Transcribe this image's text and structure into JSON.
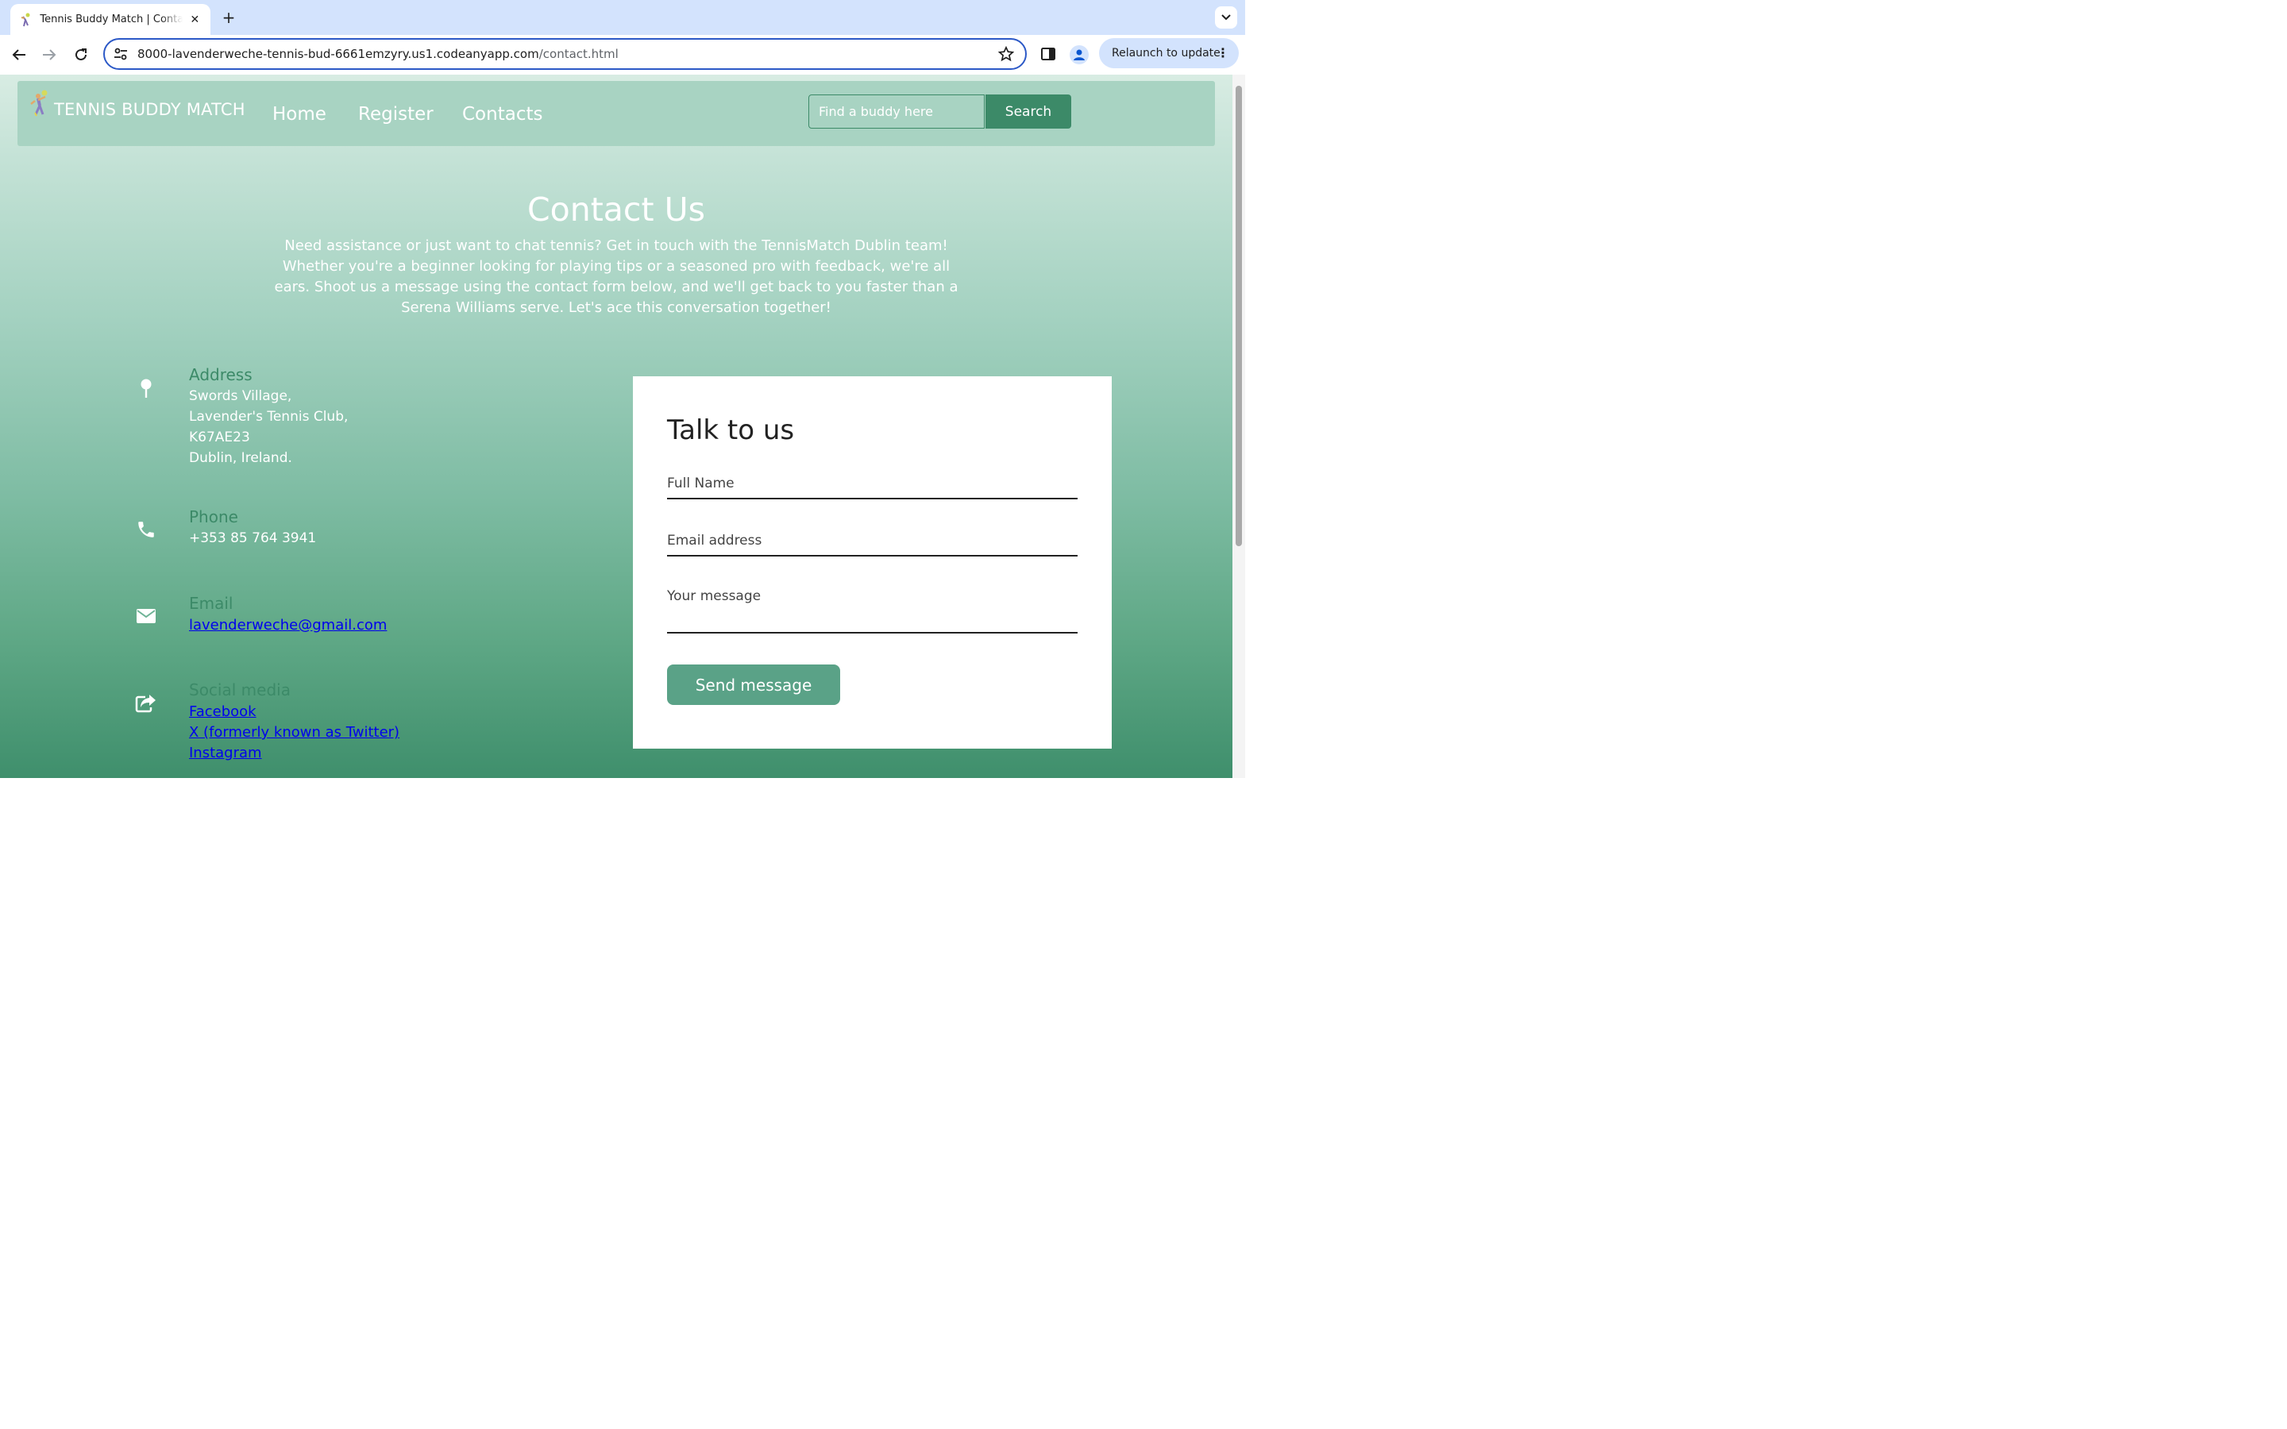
{
  "browser": {
    "tab_title": "Tennis Buddy Match | Contact",
    "url_host": "8000-lavenderweche-tennis-bud-6661emzyry.us1.codeanyapp.com",
    "url_path": "/contact.html",
    "relaunch_label": "Relaunch to update"
  },
  "site": {
    "logo_text": "TENNIS BUDDY MATCH",
    "nav": [
      "Home",
      "Register",
      "Contacts"
    ],
    "search_placeholder": "Find a buddy here",
    "search_button": "Search"
  },
  "contact": {
    "title": "Contact Us",
    "intro": "Need assistance or just want to chat tennis? Get in touch with the TennisMatch Dublin team! Whether you're a beginner looking for playing tips or a seasoned pro with feedback, we're all ears. Shoot us a message using the contact form below, and we'll get back to you faster than a Serena Williams serve. Let's ace this conversation together!",
    "address": {
      "heading": "Address",
      "lines": [
        "Swords Village,",
        "Lavender's Tennis Club,",
        "K67AE23",
        "Dublin, Ireland."
      ]
    },
    "phone": {
      "heading": "Phone",
      "value": "+353 85 764 3941"
    },
    "email": {
      "heading": "Email",
      "value": "lavenderweche@gmail.com"
    },
    "social": {
      "heading": "Social media",
      "links": [
        "Facebook",
        "X (formerly known as Twitter)",
        "Instagram"
      ]
    }
  },
  "form": {
    "title": "Talk to us",
    "name_placeholder": "Full Name",
    "email_placeholder": "Email address",
    "message_placeholder": "Your message",
    "submit_label": "Send message"
  },
  "colors": {
    "brand_green": "#3c8a68",
    "button_green": "#5aa287",
    "link_blue": "#0000ee",
    "omnibox_focus": "#2c59c7"
  },
  "icons": {
    "address": "pin-icon",
    "phone": "phone-icon",
    "email": "envelope-icon",
    "social": "share-icon"
  }
}
